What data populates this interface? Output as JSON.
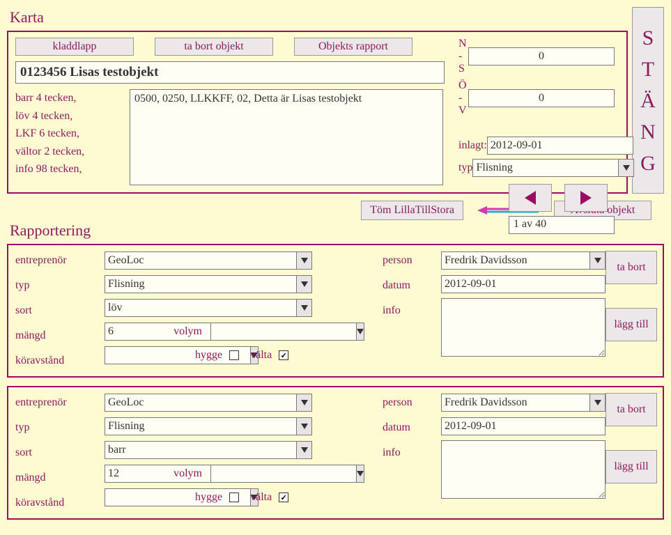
{
  "karta": {
    "title": "Karta",
    "buttons": {
      "kladdlapp": "kladdlapp",
      "tabort": "ta bort objekt",
      "rapport": "Objekts rapport"
    },
    "object_title": "0123456 Lisas testobjekt",
    "hints": [
      "barr 4 tecken,",
      "löv 4 tecken,",
      "LKF 6 tecken,",
      "vältor 2 tecken,",
      "info 98 tecken,"
    ],
    "details": "0500, 0250, LLKKFF, 02,  Detta är Lisas testobjekt",
    "meta": {
      "ns_label": "N - S",
      "ns_value": "0",
      "ov_label": "Ö - V",
      "ov_value": "0",
      "inlagt_label": "inlagt:",
      "inlagt_value": "2012-09-01",
      "typ_label": "typ",
      "typ_value": "Flisning",
      "pager": "1 av 40"
    }
  },
  "stang": [
    "S",
    "T",
    "Ä",
    "N",
    "G"
  ],
  "mid": {
    "tom": "Töm LillaTillStora",
    "avsluta": "Avsluta objekt"
  },
  "rapportering": {
    "title": "Rapportering",
    "labels": {
      "entreprenor": "entreprenör",
      "typ": "typ",
      "sort": "sort",
      "mangd": "mängd",
      "volym": "volym",
      "koravstand": "köravstånd",
      "hygge": "hygge",
      "valta": "välta",
      "person": "person",
      "datum": "datum",
      "info": "info",
      "tabort": "ta bort",
      "laggtill": "lägg till"
    },
    "rows": [
      {
        "entreprenor": "GeoLoc",
        "typ": "Flisning",
        "sort": "löv",
        "mangd": "6",
        "volym": "",
        "koravstand": "",
        "hygge": false,
        "valta": true,
        "person": "Fredrik Davidsson",
        "datum": "2012-09-01",
        "info": ""
      },
      {
        "entreprenor": "GeoLoc",
        "typ": "Flisning",
        "sort": "barr",
        "mangd": "12",
        "volym": "",
        "koravstand": "",
        "hygge": false,
        "valta": true,
        "person": "Fredrik Davidsson",
        "datum": "2012-09-01",
        "info": ""
      }
    ]
  }
}
